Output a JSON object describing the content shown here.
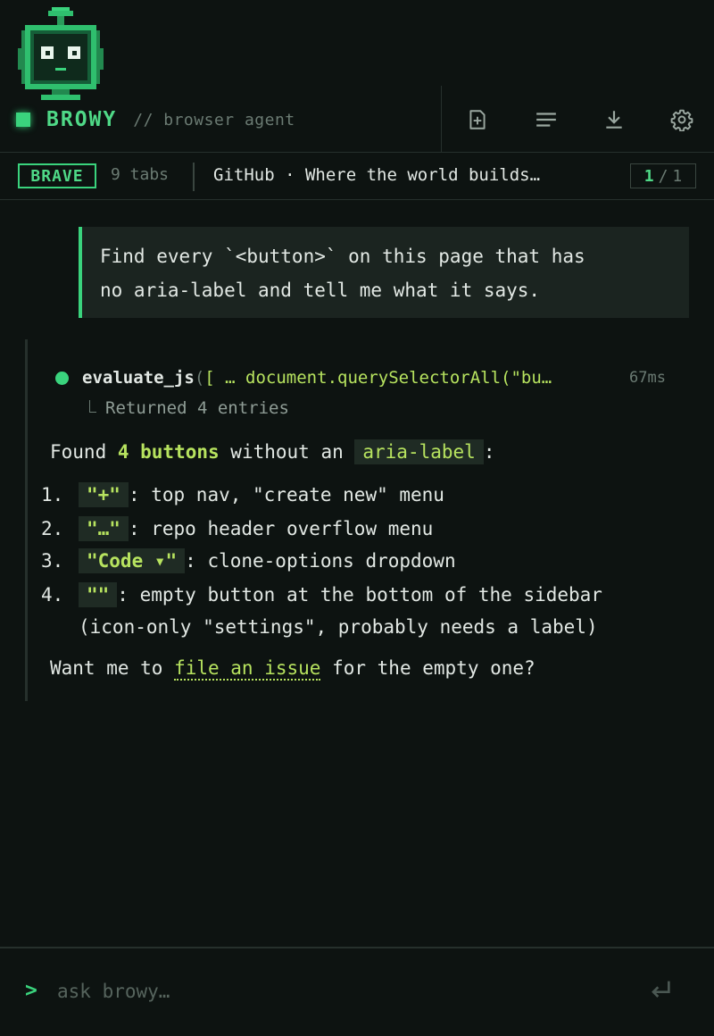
{
  "header": {
    "brand_name": "BROWY",
    "brand_subtitle": "// browser agent",
    "toolbar": [
      {
        "icon": "new-chat-icon"
      },
      {
        "icon": "list-icon"
      },
      {
        "icon": "download-icon"
      },
      {
        "icon": "gear-icon"
      }
    ]
  },
  "tabbar": {
    "browser": "BRAVE",
    "tab_count": "9 tabs",
    "active_tab_title": "GitHub · Where the world builds…",
    "page_current": "1",
    "page_sep": "/",
    "page_total": "1"
  },
  "user_message": {
    "line1": "Find every `<button>` on this page that has",
    "line2": "no aria-label and tell me what it says."
  },
  "tool_call": {
    "name": "evaluate_js",
    "open_paren": "(",
    "args": "[ … document.querySelectorAll(\"button\")",
    "duration": "67ms",
    "result": "Returned 4 entries"
  },
  "response": {
    "intro_pre": "Found ",
    "intro_count": "4 buttons",
    "intro_mid": " without an ",
    "intro_code": "aria-label",
    "intro_post": ":",
    "items": [
      {
        "num": "1.",
        "code": "\"+\"",
        "text": ": top nav, \"create new\" menu"
      },
      {
        "num": "2.",
        "code": "\"…\"",
        "text": ": repo header overflow menu"
      },
      {
        "num": "3.",
        "code": "\"Code ▾\"",
        "text": ": clone-options dropdown"
      },
      {
        "num": "4.",
        "code": "\"\"",
        "text": ": empty button at the bottom of the sidebar",
        "text2": "(icon-only \"settings\", probably needs a label)"
      }
    ],
    "outro_pre": "Want me to ",
    "outro_link": "file an issue",
    "outro_post": " for the empty one?"
  },
  "composer": {
    "caret": ">",
    "placeholder": "ask browy…"
  },
  "colors": {
    "background": "#0d1311",
    "accent": "#3ad37d",
    "highlight": "#b7e35f",
    "muted": "#6b7b73"
  }
}
